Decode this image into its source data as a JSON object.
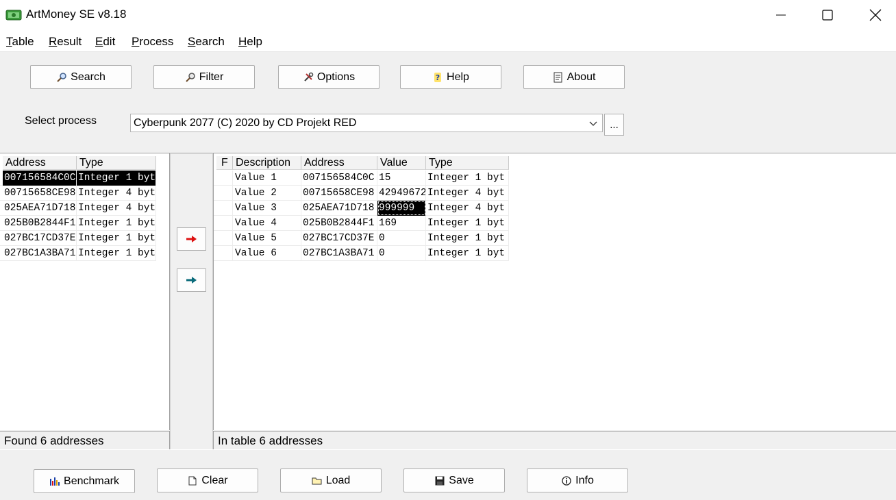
{
  "window": {
    "title": "ArtMoney SE v8.18"
  },
  "menu": [
    "Table",
    "Result",
    "Edit",
    "Process",
    "Search",
    "Help"
  ],
  "toolbar": [
    {
      "label": "Search",
      "icon": "magnifier-icon"
    },
    {
      "label": "Filter",
      "icon": "filter-magnifier-icon"
    },
    {
      "label": "Options",
      "icon": "tools-icon"
    },
    {
      "label": "Help",
      "icon": "question-icon"
    },
    {
      "label": "About",
      "icon": "document-icon"
    }
  ],
  "process": {
    "label": "Select process",
    "selected": "Cyberpunk 2077 (C) 2020 by CD Projekt RED",
    "more_label": "..."
  },
  "search_results": {
    "columns": [
      "Address",
      "Type"
    ],
    "rows": [
      [
        "007156584C0C",
        "Integer 1 byt"
      ],
      [
        "00715658CE98",
        "Integer 4 byt"
      ],
      [
        "025AEA71D718",
        "Integer 4 byt"
      ],
      [
        "025B0B2844F1",
        "Integer 1 byt"
      ],
      [
        "027BC17CD37E",
        "Integer 1 byt"
      ],
      [
        "027BC1A3BA71",
        "Integer 1 byt"
      ]
    ],
    "status": "Found 6 addresses"
  },
  "table": {
    "columns": [
      "F",
      "Description",
      "Address",
      "Value",
      "Type"
    ],
    "rows": [
      [
        "",
        "Value 1",
        "007156584C0C",
        "15",
        "Integer 1 byt"
      ],
      [
        "",
        "Value 2",
        "00715658CE98",
        "42949672",
        "Integer 4 byt"
      ],
      [
        "",
        "Value 3",
        "025AEA71D718",
        "999999",
        "Integer 4 byt"
      ],
      [
        "",
        "Value 4",
        "025B0B2844F1",
        "169",
        "Integer 1 byt"
      ],
      [
        "",
        "Value 5",
        "027BC17CD37E",
        "0",
        "Integer 1 byt"
      ],
      [
        "",
        "Value 6",
        "027BC1A3BA71",
        "0",
        "Integer 1 byt"
      ]
    ],
    "status": "In table 6 addresses"
  },
  "bottom_buttons": [
    {
      "label": "Benchmark",
      "icon": "chart-icon"
    },
    {
      "label": "Clear",
      "icon": "blank-page-icon"
    },
    {
      "label": "Load",
      "icon": "folder-icon"
    },
    {
      "label": "Save",
      "icon": "floppy-icon"
    },
    {
      "label": "Info",
      "icon": "info-icon"
    }
  ]
}
